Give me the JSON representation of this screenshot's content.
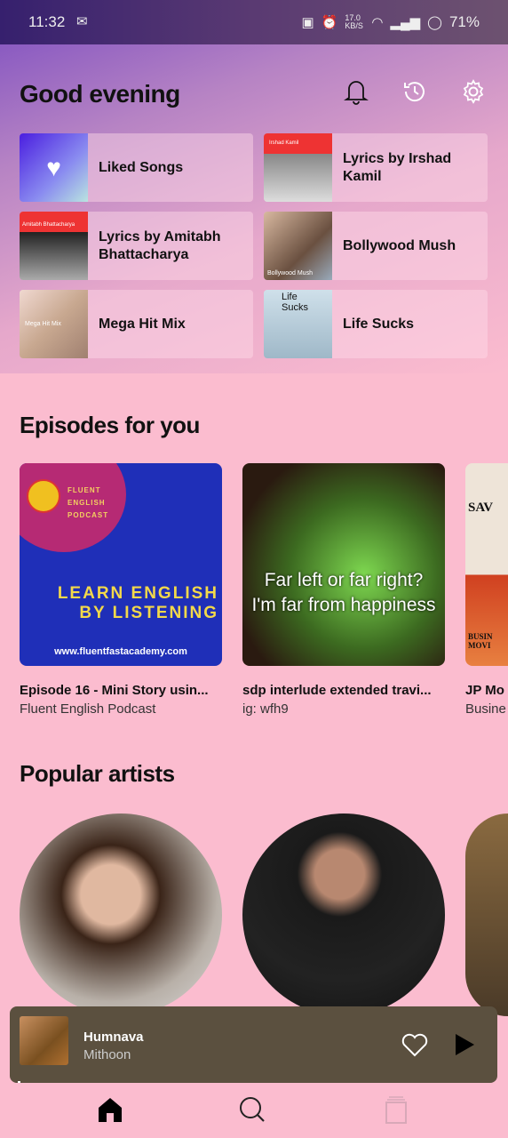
{
  "status": {
    "time": "11:32",
    "net_speed": "17.0 KB/S",
    "battery": "71%"
  },
  "header": {
    "title": "Good evening"
  },
  "shortcuts": [
    {
      "label": "Liked Songs"
    },
    {
      "label": "Lyrics by Irshad Kamil",
      "art_text": "Irshad Kamil"
    },
    {
      "label": "Lyrics by Amitabh Bhattacharya",
      "art_text": "Amitabh Bhattacharya"
    },
    {
      "label": "Bollywood Mush",
      "art_text": "Bollywood Mush"
    },
    {
      "label": "Mega Hit Mix",
      "art_text": "Mega Hit Mix"
    },
    {
      "label": "Life Sucks",
      "art_text": "Life Sucks"
    }
  ],
  "episodes": {
    "heading": "Episodes for you",
    "items": [
      {
        "title": "Episode 16 - Mini Story usin...",
        "subtitle": "Fluent English Podcast",
        "art_lines": [
          "FLUENT",
          "ENGLISH",
          "PODCAST",
          "LEARN ENGLISH",
          "BY LISTENING",
          "www.fluentfastacademy.com"
        ]
      },
      {
        "title": "sdp interlude extended travi...",
        "subtitle": "ig: wfh9",
        "art_lines": [
          "Far left or far right?",
          "I'm far from happiness"
        ]
      },
      {
        "title": "JP Mo",
        "subtitle": "Busine",
        "art_lines": [
          "SAV",
          "BUSIN MOVI"
        ]
      }
    ]
  },
  "artists": {
    "heading": "Popular artists"
  },
  "player": {
    "title": "Humnava",
    "artist": "Mithoon",
    "colors": {
      "bg": "#5b503f"
    }
  },
  "nav": [
    "home",
    "search",
    "library"
  ]
}
